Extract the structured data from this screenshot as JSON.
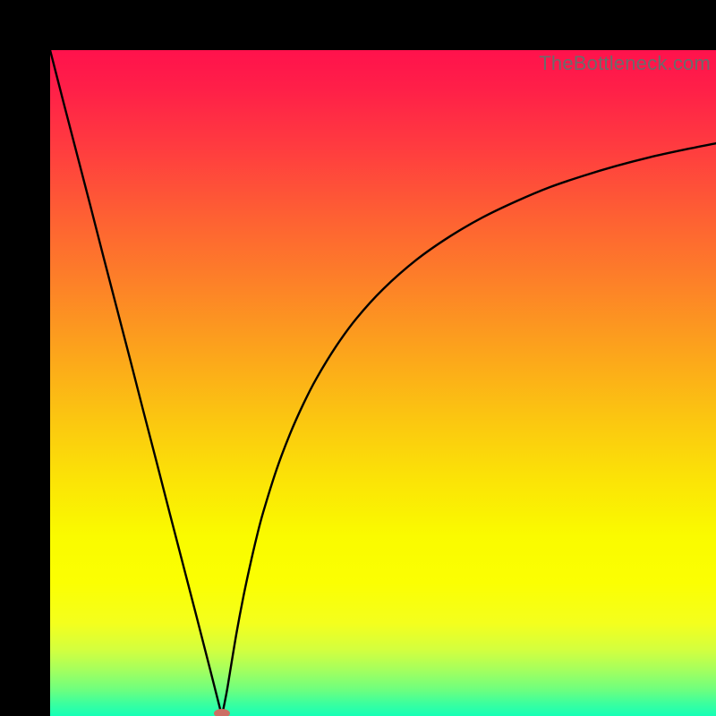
{
  "watermark": "TheBottleneck.com",
  "chart_data": {
    "type": "line",
    "title": "",
    "xlabel": "",
    "ylabel": "",
    "xlim": [
      0,
      100
    ],
    "ylim": [
      0,
      100
    ],
    "x_optimum": 25.8,
    "marker": {
      "x": 25.8,
      "y": 0,
      "color": "#cb6e64"
    },
    "left_branch": {
      "x": [
        0,
        2,
        4,
        6,
        8,
        10,
        12,
        14,
        16,
        18,
        20,
        22,
        24,
        25.8
      ],
      "y": [
        100,
        92.2,
        84.5,
        76.8,
        69.0,
        61.3,
        53.6,
        45.8,
        38.1,
        30.3,
        22.6,
        14.9,
        7.1,
        0
      ]
    },
    "right_branch": {
      "x": [
        25.8,
        26.5,
        27,
        28,
        29,
        30,
        31,
        32,
        34,
        36,
        38,
        40,
        43,
        46,
        50,
        55,
        60,
        65,
        70,
        75,
        80,
        85,
        90,
        95,
        100
      ],
      "y": [
        0,
        3.5,
        6.5,
        12.5,
        17.8,
        22.5,
        26.8,
        30.6,
        37.0,
        42.3,
        46.8,
        50.7,
        55.6,
        59.7,
        64.1,
        68.5,
        72.0,
        74.9,
        77.3,
        79.4,
        81.1,
        82.6,
        83.9,
        85.0,
        86.0
      ]
    },
    "gradient_stops": [
      {
        "offset": 0.0,
        "color": "#ff124c"
      },
      {
        "offset": 0.06,
        "color": "#ff2048"
      },
      {
        "offset": 0.15,
        "color": "#ff3d3f"
      },
      {
        "offset": 0.25,
        "color": "#fe6033"
      },
      {
        "offset": 0.35,
        "color": "#fd8128"
      },
      {
        "offset": 0.45,
        "color": "#fca31c"
      },
      {
        "offset": 0.55,
        "color": "#fbc511"
      },
      {
        "offset": 0.65,
        "color": "#fbe506"
      },
      {
        "offset": 0.73,
        "color": "#fafb00"
      },
      {
        "offset": 0.8,
        "color": "#fbff02"
      },
      {
        "offset": 0.86,
        "color": "#f4ff1d"
      },
      {
        "offset": 0.9,
        "color": "#d4ff3e"
      },
      {
        "offset": 0.93,
        "color": "#a6ff5d"
      },
      {
        "offset": 0.96,
        "color": "#6fff7e"
      },
      {
        "offset": 0.98,
        "color": "#3eff9c"
      },
      {
        "offset": 1.0,
        "color": "#16ffb7"
      }
    ]
  }
}
